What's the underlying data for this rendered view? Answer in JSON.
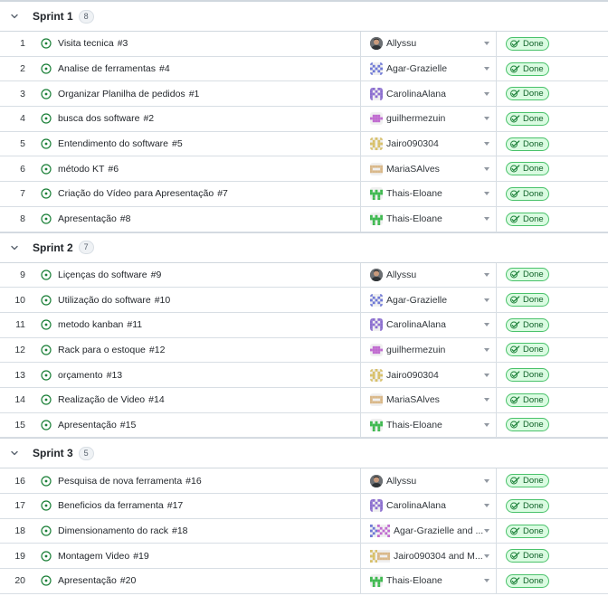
{
  "groups": [
    {
      "title": "Sprint 1",
      "count": "8",
      "rows": [
        {
          "num": "1",
          "title": "Visita tecnica",
          "issue": "#3",
          "assignee": "Allyssu",
          "avatar": "photo",
          "status": "Done"
        },
        {
          "num": "2",
          "title": "Analise de ferramentas",
          "issue": "#4",
          "assignee": "Agar-Grazielle",
          "avatar": "blue",
          "status": "Done"
        },
        {
          "num": "3",
          "title": "Organizar Planilha de pedidos",
          "issue": "#1",
          "assignee": "CarolinaAlana",
          "avatar": "purple",
          "status": "Done"
        },
        {
          "num": "4",
          "title": "busca dos software",
          "issue": "#2",
          "assignee": "guilhermezuin",
          "avatar": "magenta",
          "status": "Done"
        },
        {
          "num": "5",
          "title": "Entendimento do software",
          "issue": "#5",
          "assignee": "Jairo090304",
          "avatar": "yellow",
          "status": "Done"
        },
        {
          "num": "6",
          "title": "método KT",
          "issue": "#6",
          "assignee": "MariaSAlves",
          "avatar": "tan",
          "status": "Done"
        },
        {
          "num": "7",
          "title": "Criação do Vídeo para Apresentação",
          "issue": "#7",
          "assignee": "Thais-Eloane",
          "avatar": "green",
          "status": "Done"
        },
        {
          "num": "8",
          "title": "Apresentação",
          "issue": "#8",
          "assignee": "Thais-Eloane",
          "avatar": "green",
          "status": "Done"
        }
      ]
    },
    {
      "title": "Sprint 2",
      "count": "7",
      "rows": [
        {
          "num": "9",
          "title": "Liçenças do software",
          "issue": "#9",
          "assignee": "Allyssu",
          "avatar": "photo",
          "status": "Done"
        },
        {
          "num": "10",
          "title": "Utilização do software",
          "issue": "#10",
          "assignee": "Agar-Grazielle",
          "avatar": "blue",
          "status": "Done"
        },
        {
          "num": "11",
          "title": "metodo kanban",
          "issue": "#11",
          "assignee": "CarolinaAlana",
          "avatar": "purple",
          "status": "Done"
        },
        {
          "num": "12",
          "title": "Rack para o estoque",
          "issue": "#12",
          "assignee": "guilhermezuin",
          "avatar": "magenta",
          "status": "Done"
        },
        {
          "num": "13",
          "title": "orçamento",
          "issue": "#13",
          "assignee": "Jairo090304",
          "avatar": "yellow",
          "status": "Done"
        },
        {
          "num": "14",
          "title": "Realização de Video",
          "issue": "#14",
          "assignee": "MariaSAlves",
          "avatar": "tan",
          "status": "Done"
        },
        {
          "num": "15",
          "title": "Apresentação",
          "issue": "#15",
          "assignee": "Thais-Eloane",
          "avatar": "green",
          "status": "Done"
        }
      ]
    },
    {
      "title": "Sprint 3",
      "count": "5",
      "rows": [
        {
          "num": "16",
          "title": "Pesquisa de nova ferramenta",
          "issue": "#16",
          "assignee": "Allyssu",
          "avatar": "photo",
          "status": "Done"
        },
        {
          "num": "17",
          "title": "Beneficios da ferramenta",
          "issue": "#17",
          "assignee": "CarolinaAlana",
          "avatar": "purple",
          "status": "Done"
        },
        {
          "num": "18",
          "title": "Dimensionamento do rack",
          "issue": "#18",
          "assignee": "Agar-Grazielle and ...",
          "avatar": "blue-pink",
          "status": "Done"
        },
        {
          "num": "19",
          "title": "Montagem Video",
          "issue": "#19",
          "assignee": "Jairo090304 and M...",
          "avatar": "yellow-tan",
          "status": "Done"
        },
        {
          "num": "20",
          "title": "Apresentação",
          "issue": "#20",
          "assignee": "Thais-Eloane",
          "avatar": "green",
          "status": "Done"
        }
      ]
    }
  ],
  "colors": {
    "status_bg": "#dafbe1",
    "status_border": "#4ac26b",
    "status_text": "#116329",
    "open_issue_icon": "#1a7f37",
    "avatar_blue": "#6e78d6",
    "avatar_purple": "#8c6fd0",
    "avatar_magenta": "#c06cd0",
    "avatar_yellow": "#d8c06a",
    "avatar_tan": "#d9b889",
    "avatar_green": "#3fb950"
  },
  "icons": {
    "group_toggle": "chevron-down-icon",
    "issue": "issue-opened-icon",
    "status": "check-icon",
    "assignee_menu": "triangle-down-icon"
  }
}
